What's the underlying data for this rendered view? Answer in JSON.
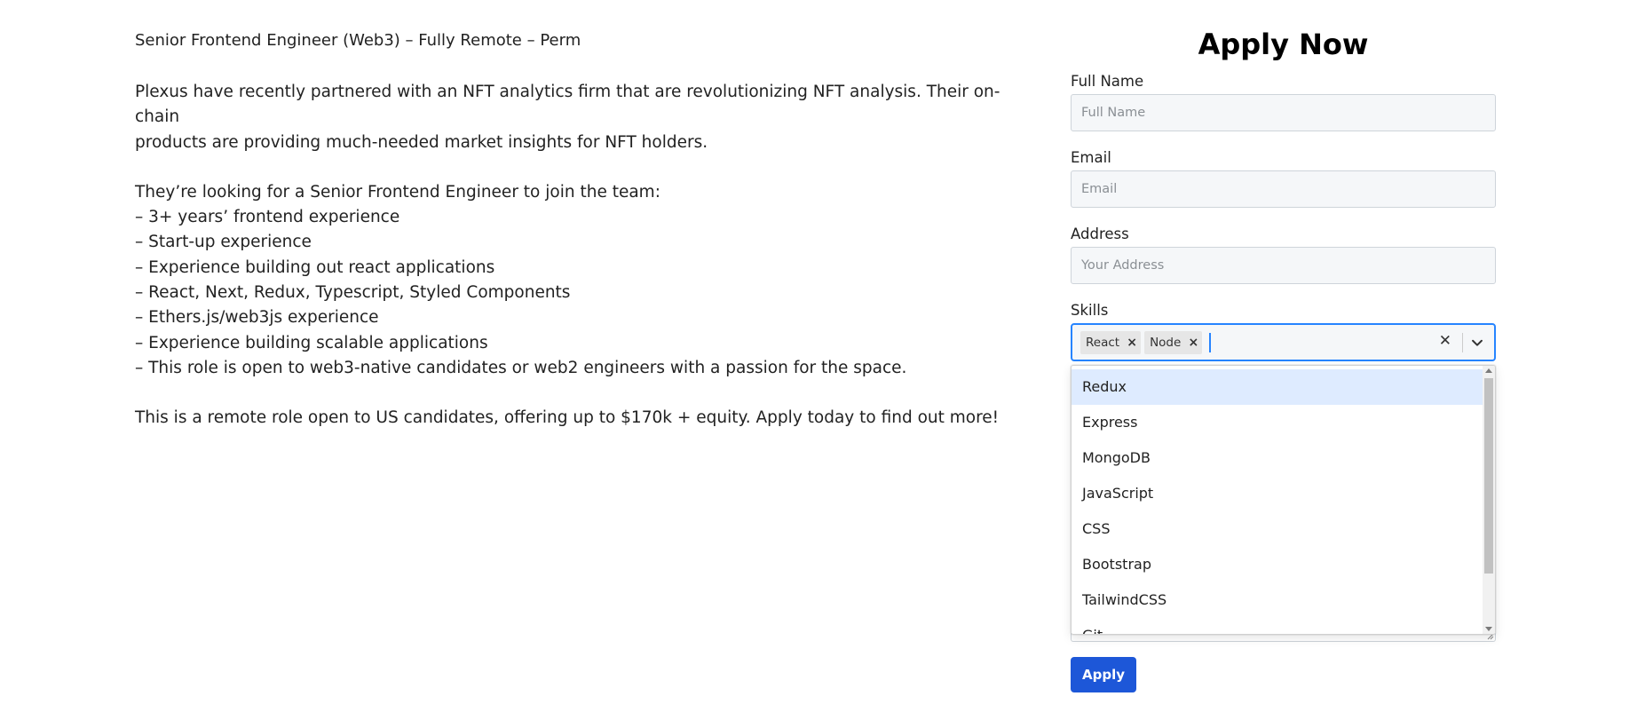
{
  "job": {
    "title": "Senior Frontend Engineer (Web3) – Fully Remote – Perm",
    "intro_1": "Plexus have recently partnered with an NFT analytics firm that are revolutionizing NFT analysis. Their on-chain",
    "intro_2": "products are providing much-needed market insights for NFT holders.",
    "lead": "They’re looking for a Senior Frontend Engineer to join the team:",
    "requirements": [
      "– 3+ years’ frontend experience",
      "– Start-up experience",
      "– Experience building out react applications",
      "– React, Next, Redux, Typescript, Styled Components",
      "– Ethers.js/web3js experience",
      "– Experience building scalable applications",
      "– This role is open to web3-native candidates or web2 engineers with a passion for the space."
    ],
    "closing": "This is a remote role open to US candidates, offering up to $170k + equity. Apply today to find out more!"
  },
  "form": {
    "title": "Apply Now",
    "full_name": {
      "label": "Full Name",
      "placeholder": "Full Name"
    },
    "email": {
      "label": "Email",
      "placeholder": "Email"
    },
    "address": {
      "label": "Address",
      "placeholder": "Your Address"
    },
    "skills": {
      "label": "Skills",
      "selected": [
        "React",
        "Node"
      ],
      "options": [
        "Redux",
        "Express",
        "MongoDB",
        "JavaScript",
        "CSS",
        "Bootstrap",
        "TailwindCSS",
        "Git"
      ],
      "highlighted": "Redux"
    },
    "submit_label": "Apply"
  },
  "icons": {
    "remove": "x-icon",
    "clear": "x-icon",
    "dropdown": "chevron-down-icon"
  },
  "colors": {
    "accent": "#1d57d8",
    "focus": "#2684ff",
    "option_hover": "#deebff"
  }
}
